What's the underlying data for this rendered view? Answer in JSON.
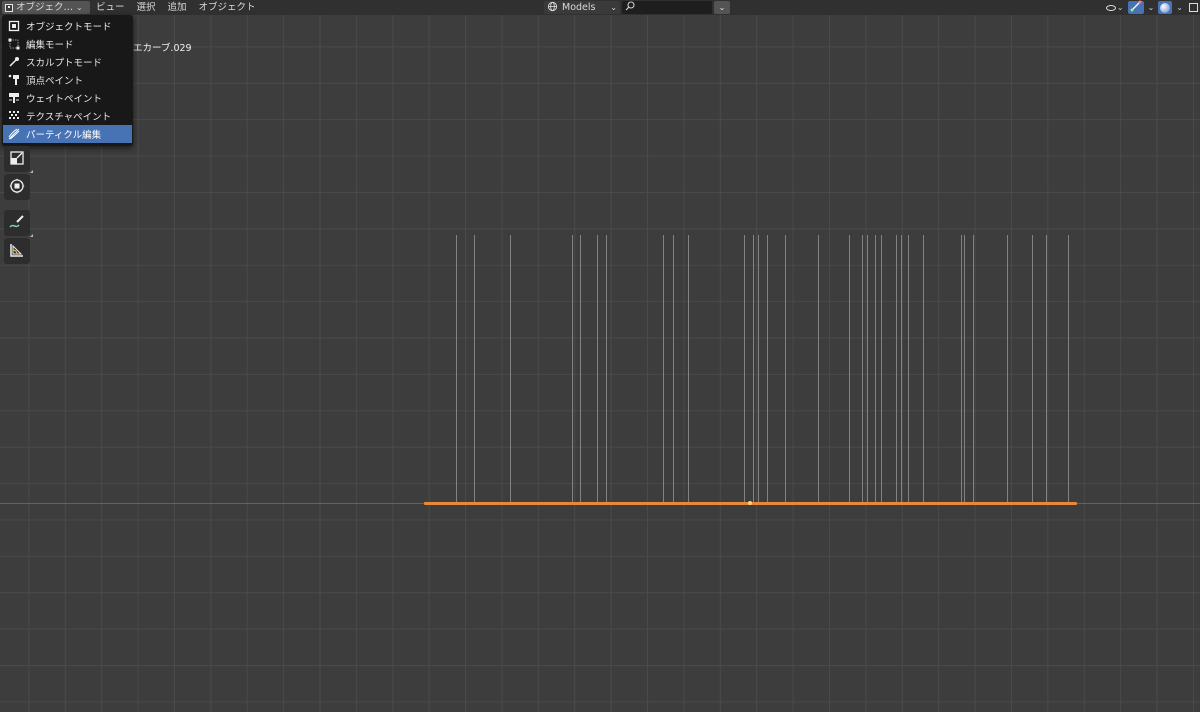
{
  "header": {
    "mode_label": "オブジェク…",
    "menus": [
      "ビュー",
      "選択",
      "追加",
      "オブジェクト"
    ],
    "collection_label": "Models",
    "search_placeholder": ""
  },
  "mode_menu": {
    "items": [
      {
        "label": "オブジェクトモード",
        "icon": "object-mode-icon",
        "active": false
      },
      {
        "label": "編集モード",
        "icon": "edit-mode-icon",
        "active": false
      },
      {
        "label": "スカルプトモード",
        "icon": "sculpt-mode-icon",
        "active": false
      },
      {
        "label": "頂点ペイント",
        "icon": "vertex-paint-icon",
        "active": false
      },
      {
        "label": "ウェイトペイント",
        "icon": "weight-paint-icon",
        "active": false
      },
      {
        "label": "テクスチャペイント",
        "icon": "texture-paint-icon",
        "active": false
      },
      {
        "label": "パーティクル編集",
        "icon": "particle-edit-icon",
        "active": true
      }
    ]
  },
  "viewport": {
    "object_label": "エカーブ.029",
    "colors": {
      "background": "#3d3d3d",
      "grid": "#4a4a4a",
      "x_axis": "#b0423f",
      "curve": "#e8893a",
      "hair": "#9a9a9a",
      "accent": "#4772b3"
    }
  },
  "toolbar": {
    "tools": [
      "scale-icon",
      "transform-icon",
      "annotate-icon",
      "measure-icon"
    ]
  }
}
